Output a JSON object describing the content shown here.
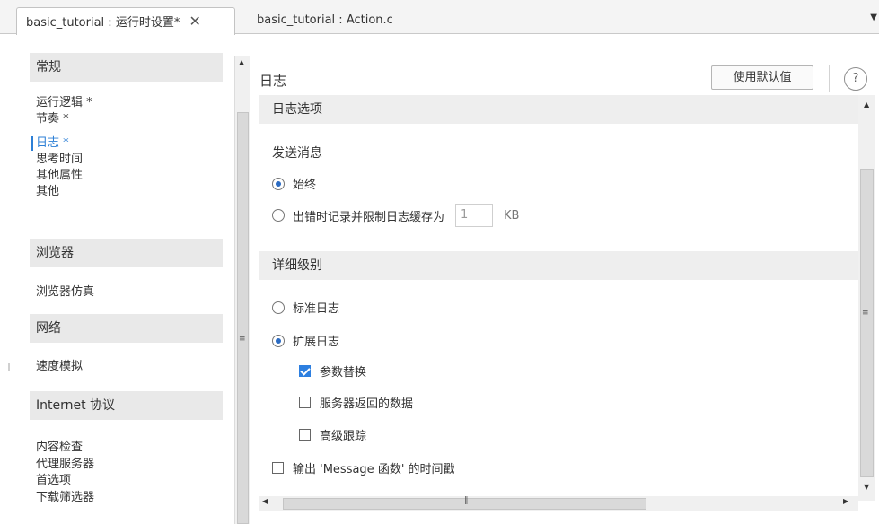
{
  "tabs": [
    {
      "label": "basic_tutorial : 运行时设置*",
      "close": "✕"
    },
    {
      "label": "basic_tutorial : Action.c"
    }
  ],
  "tab_menu_icon": "chevron-down-icon",
  "nav": {
    "groups": {
      "general": "常规",
      "browser": "浏览器",
      "network": "网络",
      "internet": "Internet 协议"
    },
    "general_items": [
      "运行逻辑 *",
      "节奏 *",
      "日志 *",
      "思考时间",
      "其他属性",
      "其他"
    ],
    "browser_items": [
      "浏览器仿真"
    ],
    "network_items": [
      "速度模拟"
    ],
    "internet_items": [
      "内容检查",
      "代理服务器",
      "首选项",
      "下载筛选器"
    ],
    "selected": "日志 *"
  },
  "panel": {
    "title": "日志",
    "default_button": "使用默认值",
    "help": "?"
  },
  "sections": {
    "log_options": "日志选项",
    "send_messages": "发送消息",
    "always": "始终",
    "on_error": "出错时记录并限制日志缓存为",
    "cache_value": "1",
    "cache_unit": "KB",
    "detail_level": "详细级别",
    "standard_log": "标准日志",
    "extended_log": "扩展日志",
    "param_subst": "参数替换",
    "server_data": "服务器返回的数据",
    "advanced_trace": "高级跟踪",
    "timestamp": "输出 'Message 函数' 的时间戳"
  },
  "state": {
    "send_messages": "always",
    "detail_level": "extended",
    "param_subst": true,
    "server_data": false,
    "advanced_trace": false,
    "timestamp": false
  },
  "colors": {
    "accent": "#2c7fd6",
    "section_bg": "#eeeeee",
    "checkbox_on": "#2d7fe0"
  }
}
